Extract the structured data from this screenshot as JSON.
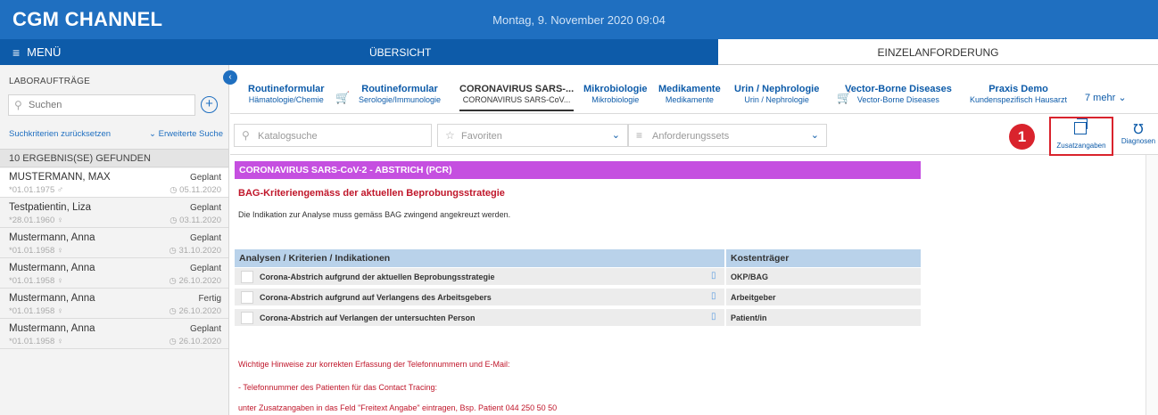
{
  "app": {
    "logo": "CGM CHANNEL",
    "datetime": "Montag, 9. November 2020 09:04"
  },
  "menubar": {
    "menu_label": "MENÜ",
    "overview_label": "ÜBERSICHT",
    "single_request_label": "EINZELANFORDERUNG"
  },
  "sidebar": {
    "title": "LABORAUFTRÄGE",
    "search_placeholder": "Suchen",
    "reset_label": "Suchkriterien zurücksetzen",
    "advanced_label": "Erweiterte Suche",
    "result_label": "10 ERGEBNIS(SE) GEFUNDEN",
    "patients": [
      {
        "name": "MUSTERMANN, MAX",
        "status": "Geplant",
        "dob": "*01.01.1975",
        "gender": "♂",
        "date": "05.11.2020"
      },
      {
        "name": "Testpatientin, Liza",
        "status": "Geplant",
        "dob": "*28.01.1960",
        "gender": "♀",
        "date": "03.11.2020"
      },
      {
        "name": "Mustermann, Anna",
        "status": "Geplant",
        "dob": "*01.01.1958",
        "gender": "♀",
        "date": "31.10.2020"
      },
      {
        "name": "Mustermann, Anna",
        "status": "Geplant",
        "dob": "*01.01.1958",
        "gender": "♀",
        "date": "26.10.2020"
      },
      {
        "name": "Mustermann, Anna",
        "status": "Fertig",
        "dob": "*01.01.1958",
        "gender": "♀",
        "date": "26.10.2020"
      },
      {
        "name": "Mustermann, Anna",
        "status": "Geplant",
        "dob": "*01.01.1958",
        "gender": "♀",
        "date": "26.10.2020"
      }
    ]
  },
  "tabs": {
    "items": [
      {
        "title": "Routineformular",
        "subtitle": "Hämatologie/Chemie"
      },
      {
        "title": "Routineformular",
        "subtitle": "Serologie/Immunologie"
      },
      {
        "title": "CORONAVIRUS SARS-...",
        "subtitle": "CORONAVIRUS SARS-CoV..."
      },
      {
        "title": "Mikrobiologie",
        "subtitle": "Mikrobiologie"
      },
      {
        "title": "Medikamente",
        "subtitle": "Medikamente"
      },
      {
        "title": "Urin / Nephrologie",
        "subtitle": "Urin / Nephrologie"
      },
      {
        "title": "Vector-Borne Diseases",
        "subtitle": "Vector-Borne Diseases"
      },
      {
        "title": "Praxis Demo",
        "subtitle": "Kundenspezifisch Hausarzt"
      }
    ],
    "more_label": "7 mehr"
  },
  "filters": {
    "catalog_placeholder": "Katalogsuche",
    "favorites_label": "Favoriten",
    "sets_label": "Anforderungssets",
    "additional_label": "Zusatzangaben",
    "diagnoses_label": "Diagnosen",
    "marker_number": "1"
  },
  "content": {
    "section_title": "CORONAVIRUS SARS-CoV-2 - ABSTRICH (PCR)",
    "bag_title": "BAG-Kriteriengemäss der aktuellen Beprobungsstrategie",
    "bag_note": "Die Indikation zur Analyse muss gemäss BAG zwingend angekreuzt werden.",
    "table": {
      "col1": "Analysen / Kriterien / Indikationen",
      "col2": "Kostenträger",
      "rows": [
        {
          "label": "Corona-Abstrich aufgrund der aktuellen Beprobungsstrategie",
          "payer": "OKP/BAG"
        },
        {
          "label": "Corona-Abstrich aufgrund auf Verlangens des Arbeitsgebers",
          "payer": "Arbeitgeber"
        },
        {
          "label": "Corona-Abstrich auf Verlangen der untersuchten Person",
          "payer": "Patient/in"
        }
      ]
    },
    "hints": [
      "Wichtige Hinweise zur korrekten Erfassung der Telefonnummern und E-Mail:",
      "- Telefonnummer des Patienten für das Contact Tracing:",
      "unter Zusatzangaben in das Feld \"Freitext Angabe\" eintragen, Bsp. Patient 044 250 50 50"
    ]
  }
}
